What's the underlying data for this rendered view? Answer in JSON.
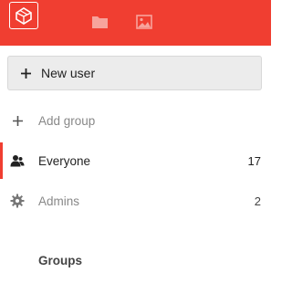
{
  "header": {
    "accent_color": "#f03e31",
    "logo_icon": "app-logo-icon",
    "apps": [
      {
        "icon": "folder-icon"
      },
      {
        "icon": "image-icon"
      }
    ]
  },
  "sidebar": {
    "new_user_label": "New user",
    "add_group_label": "Add group",
    "groups": [
      {
        "label": "Everyone",
        "count": "17",
        "icon": "user-icon",
        "active": true
      },
      {
        "label": "Admins",
        "count": "2",
        "icon": "gear-icon",
        "active": false
      }
    ],
    "groups_heading": "Groups"
  }
}
